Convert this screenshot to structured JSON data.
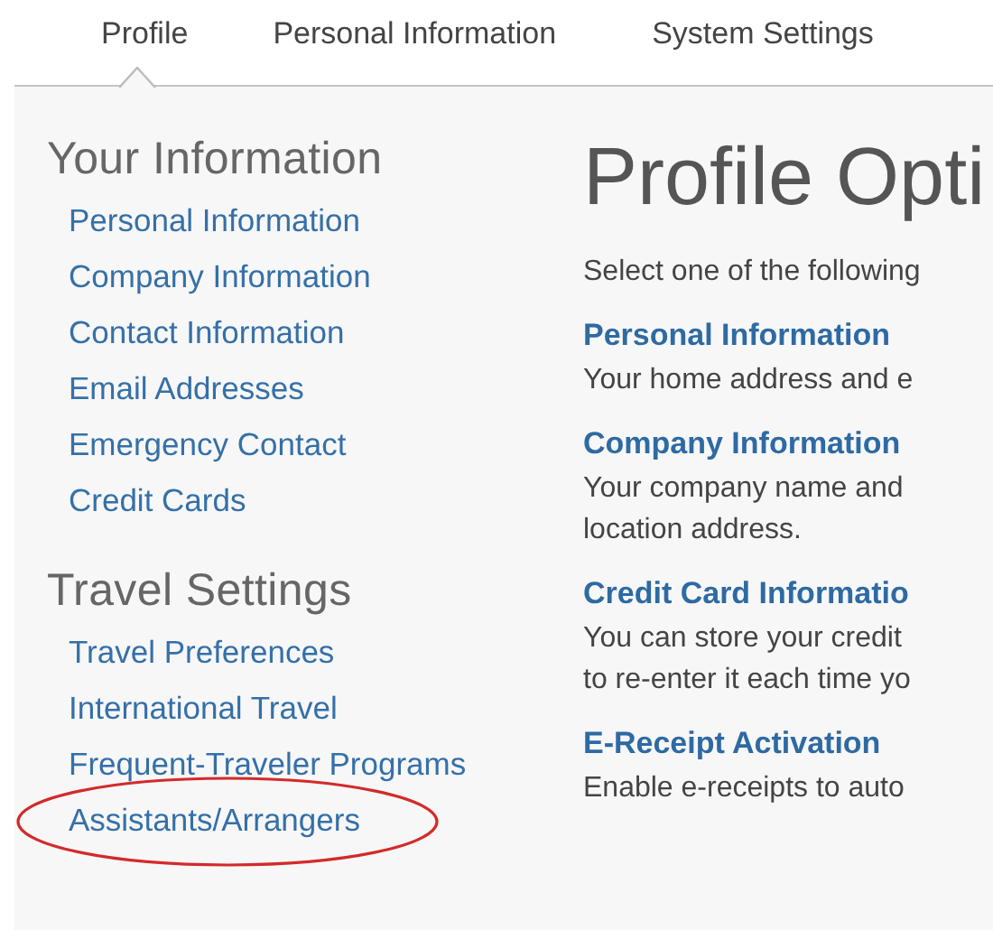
{
  "tabs": [
    {
      "label": "Profile",
      "selected": true
    },
    {
      "label": "Personal Information",
      "selected": false
    },
    {
      "label": "System Settings",
      "selected": false
    }
  ],
  "sidebar": {
    "sections": [
      {
        "title": "Your Information",
        "items": [
          {
            "label": "Personal Information",
            "circled": false
          },
          {
            "label": "Company Information",
            "circled": false
          },
          {
            "label": "Contact Information",
            "circled": false
          },
          {
            "label": "Email Addresses",
            "circled": false
          },
          {
            "label": "Emergency Contact",
            "circled": false
          },
          {
            "label": "Credit Cards",
            "circled": false
          }
        ]
      },
      {
        "title": "Travel Settings",
        "items": [
          {
            "label": "Travel Preferences",
            "circled": false
          },
          {
            "label": "International Travel",
            "circled": false
          },
          {
            "label": "Frequent-Traveler Programs",
            "circled": false
          },
          {
            "label": "Assistants/Arrangers",
            "circled": true
          }
        ]
      }
    ]
  },
  "main": {
    "title": "Profile Opti",
    "intro": "Select one of the following",
    "options": [
      {
        "title": "Personal Information",
        "lines": [
          "Your home address and e"
        ]
      },
      {
        "title": "Company Information",
        "lines": [
          "Your company name and",
          "location address."
        ]
      },
      {
        "title": "Credit Card Informatio",
        "lines": [
          "You can store your credit",
          "to re-enter it each time yo"
        ]
      },
      {
        "title": "E-Receipt Activation",
        "lines": [
          "Enable e-receipts to auto"
        ]
      }
    ]
  }
}
